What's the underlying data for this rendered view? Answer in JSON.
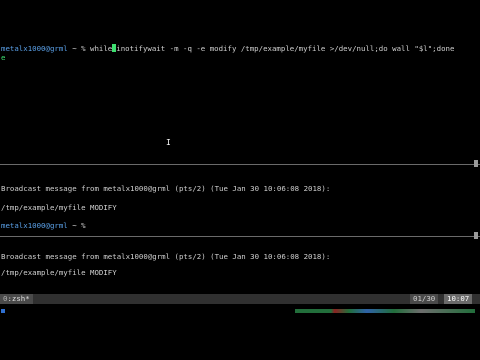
{
  "terminal": {
    "top_pane": {
      "prompt_user": "metalx1000@grml",
      "prompt_rest": " ~ % ",
      "command_before_cursor": "while",
      "command_after_cursor": "inotifywait -m -q -e modify /tmp/example/myfile >/dev/null;do wall \"$l\";done",
      "command_wrap": "e"
    },
    "middle_pane": {
      "broadcast": "Broadcast message from metalx1000@grml (pts/2) (Tue Jan 30 10:06:08 2018):",
      "event": "/tmp/example/myfile MODIFY",
      "prompt_user": "metalx1000@grml",
      "prompt_rest": " ~ % "
    },
    "bottom_pane": {
      "broadcast": "Broadcast message from metalx1000@grml (pts/2) (Tue Jan 30 10:06:08 2018):",
      "event": "/tmp/example/myfile MODIFY"
    }
  },
  "status_bar": {
    "window_index": "0",
    "window_name": ":zsh*",
    "position": "01/30",
    "time": "10:07"
  },
  "colors": {
    "background": "#000000",
    "prompt_user": "#5aa0e8",
    "cursor": "#3ee070",
    "status_bar": "#303030"
  }
}
